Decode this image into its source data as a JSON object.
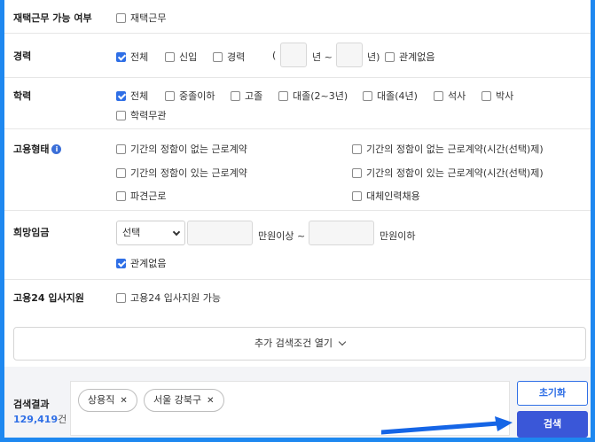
{
  "remote": {
    "label": "재택근무 가능 여부",
    "options": [
      {
        "label": "재택근무",
        "checked": false
      }
    ]
  },
  "career": {
    "label": "경력",
    "options": [
      {
        "label": "전체",
        "checked": true
      },
      {
        "label": "신입",
        "checked": false
      },
      {
        "label": "경력",
        "checked": false
      }
    ],
    "range_open": "(",
    "year_from_suffix": "년 ~",
    "year_to_suffix": "년)",
    "irrelevant": {
      "label": "관계없음",
      "checked": false
    }
  },
  "education": {
    "label": "학력",
    "options": [
      {
        "label": "전체",
        "checked": true
      },
      {
        "label": "중졸이하",
        "checked": false
      },
      {
        "label": "고졸",
        "checked": false
      },
      {
        "label": "대졸(2~3년)",
        "checked": false
      },
      {
        "label": "대졸(4년)",
        "checked": false
      },
      {
        "label": "석사",
        "checked": false
      },
      {
        "label": "박사",
        "checked": false
      },
      {
        "label": "학력무관",
        "checked": false
      }
    ]
  },
  "employment": {
    "label": "고용형태",
    "info_icon": "i",
    "options": [
      {
        "label": "기간의 정함이 없는 근로계약",
        "checked": false
      },
      {
        "label": "기간의 정함이 없는 근로계약(시간(선택)제)",
        "checked": false
      },
      {
        "label": "기간의 정함이 있는 근로계약",
        "checked": false
      },
      {
        "label": "기간의 정함이 있는 근로계약(시간(선택)제)",
        "checked": false
      },
      {
        "label": "파견근로",
        "checked": false
      },
      {
        "label": "대체인력채용",
        "checked": false
      }
    ]
  },
  "salary": {
    "label": "희망임금",
    "select_value": "선택",
    "min_suffix": "만원이상 ~",
    "max_suffix": "만원이하",
    "irrelevant": {
      "label": "관계없음",
      "checked": true
    }
  },
  "support": {
    "label": "고용24 입사지원",
    "options": [
      {
        "label": "고용24 입사지원 가능",
        "checked": false
      }
    ]
  },
  "more_conditions_label": "추가 검색조건 열기",
  "results": {
    "label": "검색결과",
    "count": "129,419",
    "unit": "건",
    "chips": [
      "상용직",
      "서울 강북구"
    ]
  },
  "buttons": {
    "reset": "초기화",
    "search": "검색"
  },
  "colors": {
    "accent": "#2f6fe6",
    "search_button": "#3a57d8",
    "frame": "#1e88f0"
  }
}
